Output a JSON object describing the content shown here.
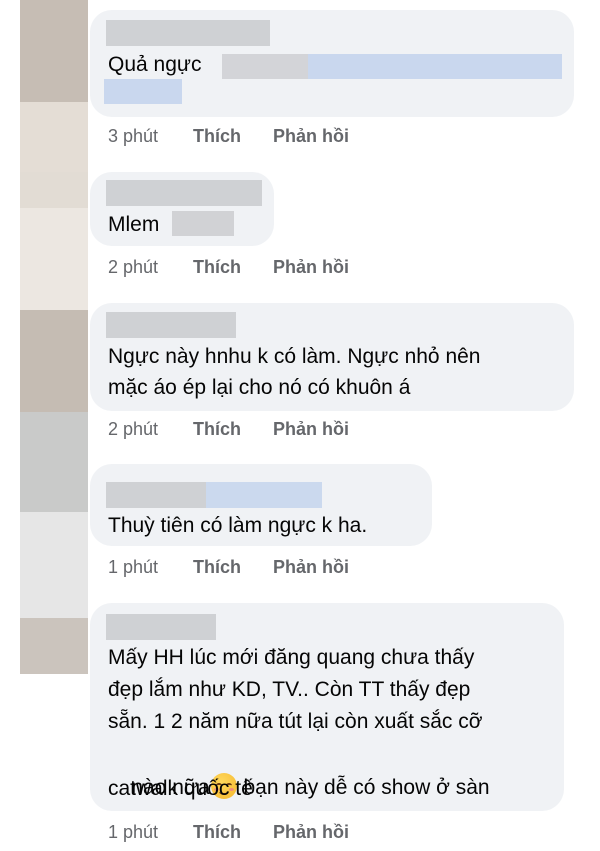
{
  "comments": [
    {
      "text": "Quả ngực",
      "time": "3 phút",
      "like_label": "Thích",
      "reply_label": "Phản hồi"
    },
    {
      "text": "Mlem",
      "time": "2 phút",
      "like_label": "Thích",
      "reply_label": "Phản hồi"
    },
    {
      "line1": "Ngực này hnhu k có làm. Ngực nhỏ nên",
      "line2": "mặc áo ép lại cho nó có khuôn á",
      "time": "2 phút",
      "like_label": "Thích",
      "reply_label": "Phản hồi"
    },
    {
      "text": "Thuỳ tiên có làm ngực k ha.",
      "time": "1 phút",
      "like_label": "Thích",
      "reply_label": "Phản hồi"
    },
    {
      "line1": "Mấy HH lúc mới đăng quang chưa thấy",
      "line2": "đẹp lắm như KD, TV.. Còn TT thấy đẹp",
      "line3": "sẵn. 1 2 năm nữa tút lại còn xuất sắc cỡ",
      "line4a": "nào nữa",
      "line4b": " bạn này dễ có show ở sàn",
      "line5": "catwalk quốc tế",
      "time": "1 phút",
      "like_label": "Thích",
      "reply_label": "Phản hồi"
    }
  ],
  "icons": {
    "emoji": "smiling-face-emoji"
  },
  "colors": {
    "bubble": "#f0f2f5",
    "meta": "#65676b",
    "text": "#050505"
  }
}
